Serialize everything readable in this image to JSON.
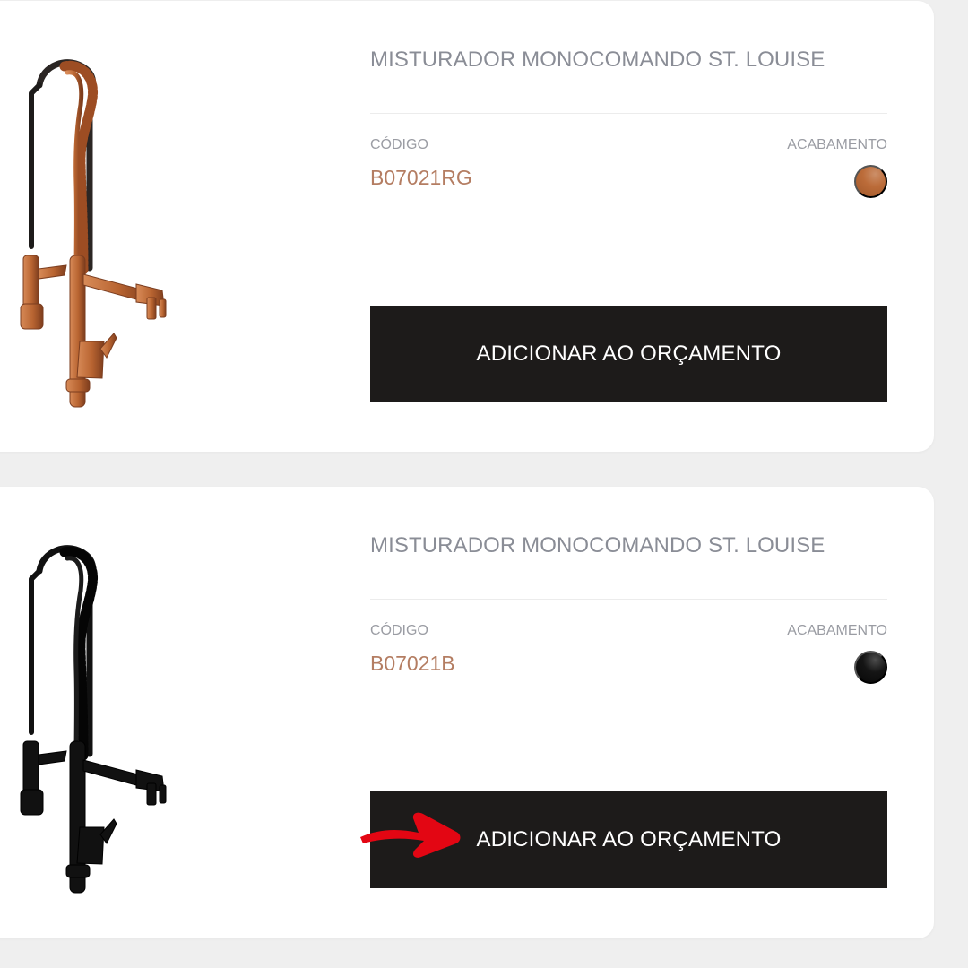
{
  "products": [
    {
      "title": "MISTURADOR MONOCOMANDO ST. LOUISE",
      "code_label": "CÓDIGO",
      "code": "B07021RG",
      "finish_label": "ACABAMENTO",
      "finish_color": "#b8642f",
      "product_color": "#c16d38",
      "button_label": "ADICIONAR AO ORÇAMENTO"
    },
    {
      "title": "MISTURADOR MONOCOMANDO ST. LOUISE",
      "code_label": "CÓDIGO",
      "code": "B07021B",
      "finish_label": "ACABAMENTO",
      "finish_color": "#080808",
      "product_color": "#111111",
      "button_label": "ADICIONAR AO ORÇAMENTO"
    }
  ],
  "annotation": {
    "arrow_color": "#e30613",
    "arrow_icon": "red-arrow-icon"
  }
}
